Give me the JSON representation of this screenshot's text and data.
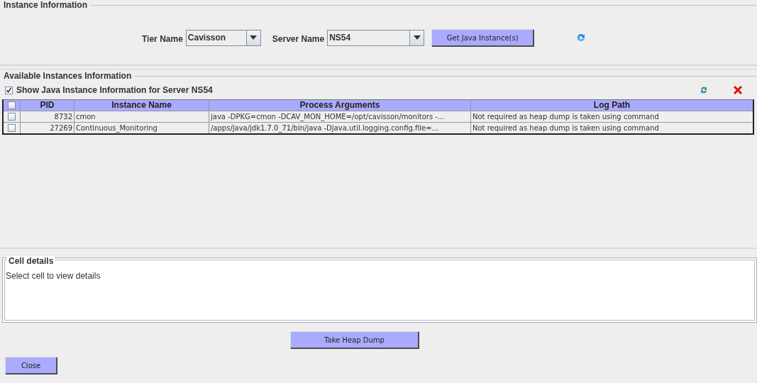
{
  "instance_information": {
    "title": "Instance Information",
    "tier_name": {
      "label": "Tier Name",
      "value": "Cavisson"
    },
    "server_name": {
      "label": "Server Name",
      "value": "NS54"
    },
    "get_button": "Get Java Instance(s)"
  },
  "available_instances": {
    "title": "Available Instances Information",
    "show_checkbox": {
      "label": "Show Java Instance Information for Server NS54",
      "checked": true
    },
    "table": {
      "columns": [
        "PID",
        "Instance Name",
        "Process Arguments",
        "Log Path"
      ],
      "header_checked": false,
      "rows": [
        {
          "checked": false,
          "cells": [
            "8732",
            "cmon",
            "java -DPKG=cmon -DCAV_MON_HOME=/opt/cavisson/monitors -...",
            "Not required as heap dump is taken using command"
          ]
        },
        {
          "checked": false,
          "cells": [
            "27269",
            "Continuous_Monitoring",
            "/apps/java/jdk1.7.0_71/bin/java -Djava.util.logging.config.file=...",
            "Not required as heap dump is taken using command"
          ]
        }
      ]
    }
  },
  "cell_details": {
    "title": "Cell details",
    "text": "Select cell to view details"
  },
  "buttons": {
    "take_heap_dump": "Take Heap Dump",
    "close": "Close"
  }
}
